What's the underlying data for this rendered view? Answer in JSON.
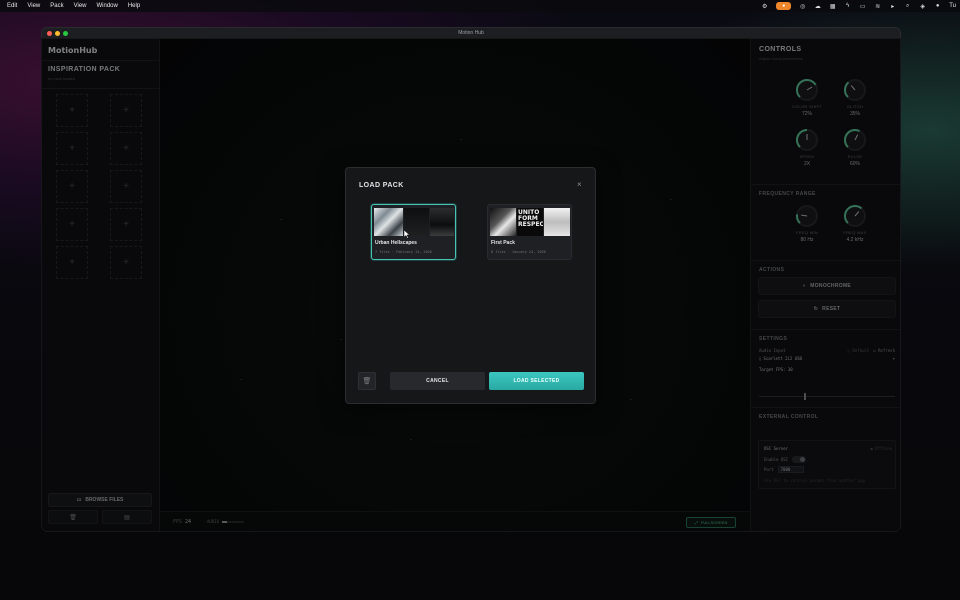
{
  "menubar": {
    "items": [
      "Edit",
      "View",
      "Pack",
      "View",
      "Window",
      "Help"
    ],
    "clock": "Tu"
  },
  "window": {
    "title": "Motion Hub"
  },
  "sidebar": {
    "logo": "MotionHub",
    "pack_title": "INSPIRATION PACK",
    "pack_subtitle": "no pack loaded",
    "slot_plus": "+",
    "browse_label": "BROWSE FILES"
  },
  "canvas": {
    "fps_label": "FPS",
    "fps_value": "24",
    "audio_label": "AUDIO",
    "audio_level": 0.22,
    "fullscreen_label": "FULLSCREEN"
  },
  "controls": {
    "title": "CONTROLS",
    "subtitle": "Adjust visual parameters",
    "knobs": [
      {
        "label": "COLOR SHIFT",
        "value": "72%",
        "level": 0.72
      },
      {
        "label": "GLITCH",
        "value": "35%",
        "level": 0.35
      },
      {
        "label": "SPEED",
        "value": "2X",
        "level": 0.5
      },
      {
        "label": "PULSE",
        "value": "60%",
        "level": 0.6
      }
    ],
    "frequency_title": "FREQUENCY RANGE",
    "freq_knobs": [
      {
        "label": "FREQ MIN",
        "value": "80 Hz",
        "level": 0.2
      },
      {
        "label": "FREQ MAX",
        "value": "4.2 kHz",
        "level": 0.65
      }
    ],
    "actions_title": "ACTIONS",
    "monochrome_label": "MONOCHROME",
    "reset_label": "RESET",
    "settings_title": "SETTINGS",
    "audio_input_label": "Audio Input",
    "audio_input_status": "○ Default",
    "refresh_label": "↻ Refresh",
    "audio_device": "Scarlett 2i2 USB",
    "target_fps_label": "Target FPS: 30",
    "fps_slider_level": 0.33,
    "external_title": "EXTERNAL CONTROL",
    "osc_title": "OSC Server",
    "osc_status": "● Offline",
    "enable_osc_label": "Enable OSC",
    "port_label": "Port",
    "port_value": "7000",
    "osc_hint": "Use OSC to control params from another app"
  },
  "modal": {
    "title": "LOAD PACK",
    "close": "×",
    "packs": [
      {
        "name": "Urban Hellscapes",
        "meta": "7 files · February 14, 2026",
        "selected": true
      },
      {
        "name": "First Pack",
        "meta": "8 files · January 24, 2026",
        "selected": false
      }
    ],
    "first_pack_thumb_text": "UNITO\nFORM\nRESPECT",
    "cancel_label": "CANCEL",
    "load_label": "LOAD SELECTED"
  },
  "colors": {
    "accent": "#45c3b4",
    "knob_arc": "#5fd1a1",
    "load_button": "#2fb4ae"
  }
}
